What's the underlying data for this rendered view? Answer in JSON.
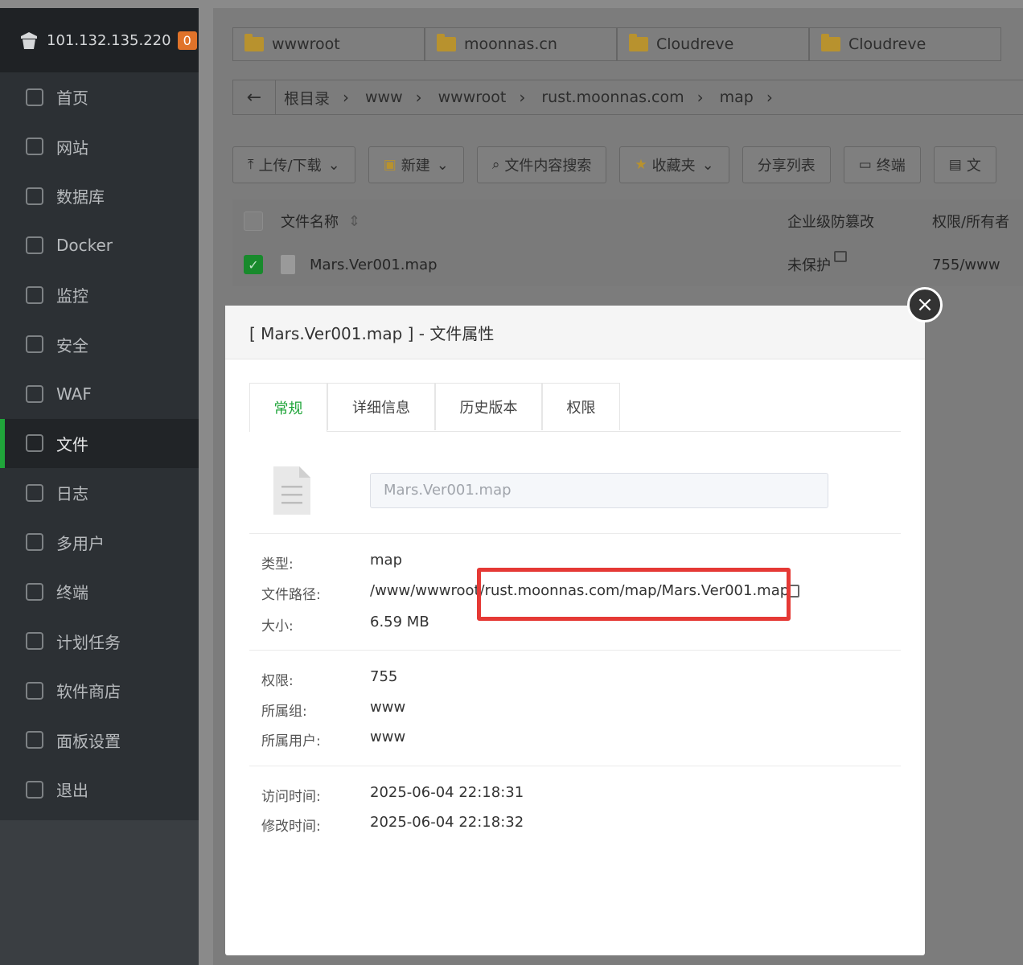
{
  "sidebar": {
    "ip": "101.132.135.220",
    "badge": "0",
    "items": [
      {
        "label": "首页",
        "icon": "home-icon"
      },
      {
        "label": "网站",
        "icon": "globe-icon"
      },
      {
        "label": "数据库",
        "icon": "database-icon"
      },
      {
        "label": "Docker",
        "icon": "docker-icon"
      },
      {
        "label": "监控",
        "icon": "monitor-icon"
      },
      {
        "label": "安全",
        "icon": "shield-icon"
      },
      {
        "label": "WAF",
        "icon": "waf-shield-icon"
      },
      {
        "label": "文件",
        "icon": "folder-icon",
        "active": true
      },
      {
        "label": "日志",
        "icon": "log-icon"
      },
      {
        "label": "多用户",
        "icon": "users-icon"
      },
      {
        "label": "终端",
        "icon": "terminal-icon"
      },
      {
        "label": "计划任务",
        "icon": "calendar-icon"
      },
      {
        "label": "软件商店",
        "icon": "apps-icon"
      },
      {
        "label": "面板设置",
        "icon": "gear-icon"
      },
      {
        "label": "退出",
        "icon": "logout-icon"
      }
    ]
  },
  "folder_tabs": [
    "wwwroot",
    "moonnas.cn",
    "Cloudreve",
    "Cloudreve"
  ],
  "breadcrumb": {
    "back": "←",
    "segments": [
      "根目录",
      "www",
      "wwwroot",
      "rust.moonnas.com",
      "map"
    ]
  },
  "toolbar": {
    "upload": "上传/下载",
    "new": "新建",
    "search": "文件内容搜索",
    "favorites": "收藏夹",
    "share": "分享列表",
    "terminal": "终端",
    "more": "文"
  },
  "table": {
    "headers": {
      "name": "文件名称",
      "tamper": "企业级防篡改",
      "perm": "权限/所有者"
    },
    "row": {
      "name": "Mars.Ver001.map",
      "tamper": "未保护",
      "perm": "755/www"
    }
  },
  "dialog": {
    "title": "[ Mars.Ver001.map ] - 文件属性",
    "tabs": [
      "常规",
      "详细信息",
      "历史版本",
      "权限"
    ],
    "filename": "Mars.Ver001.map",
    "labels": {
      "type": "类型:",
      "path": "文件路径:",
      "size": "大小:",
      "perm": "权限:",
      "group": "所属组:",
      "user": "所属用户:",
      "atime": "访问时间:",
      "mtime": "修改时间:"
    },
    "values": {
      "type": "map",
      "path": "/www/wwwroot/rust.moonnas.com/map/Mars.Ver001.map",
      "size": "6.59 MB",
      "perm": "755",
      "group": "www",
      "user": "www",
      "atime": "2025-06-04 22:18:31",
      "mtime": "2025-06-04 22:18:32"
    },
    "close": "×"
  },
  "colors": {
    "accent": "#20a53a",
    "highlight": "#e53935"
  }
}
